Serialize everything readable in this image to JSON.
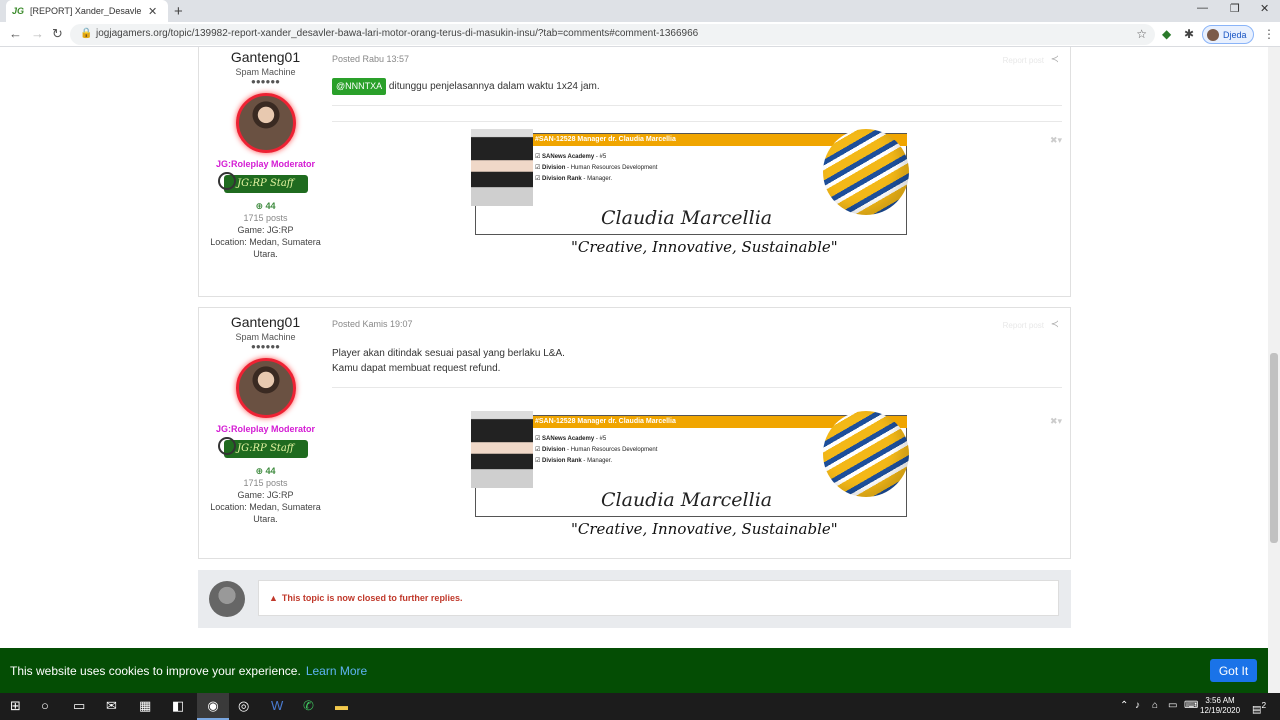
{
  "browser": {
    "tab_title": "[REPORT] Xander_Desavler (Bawa",
    "tab_favicon": "JG",
    "url": "jogjagamers.org/topic/139982-report-xander_desavler-bawa-lari-motor-orang-terus-di-masukin-insu/?tab=comments#comment-1366966",
    "profile_name": "Djeda"
  },
  "posts": [
    {
      "author": "Ganteng01",
      "rank": "Spam Machine",
      "pips": "●●●●●●",
      "group": "JG:Roleplay Moderator",
      "badge": "JG:RP Staff",
      "reputation": "44",
      "posts_count": "1715 posts",
      "game": "Game: JG:RP",
      "location": "Location: Medan, Sumatera Utara.",
      "posted": "Posted Rabu 13:57",
      "report": "Report post",
      "mention": "@NNNTXA",
      "body_1": "ditunggu penjelasannya dalam waktu 1x24 jam.",
      "body_2": ""
    },
    {
      "author": "Ganteng01",
      "rank": "Spam Machine",
      "pips": "●●●●●●",
      "group": "JG:Roleplay Moderator",
      "badge": "JG:RP Staff",
      "reputation": "44",
      "posts_count": "1715 posts",
      "game": "Game: JG:RP",
      "location": "Location: Medan, Sumatera Utara.",
      "posted": "Posted Kamis 19:07",
      "report": "Report post",
      "mention": "",
      "body_1": "Player akan ditindak sesuai pasal yang berlaku L&A.",
      "body_2": "Kamu dapat membuat request refund."
    }
  ],
  "signature": {
    "header": "#SAN-12528 Manager dr. Claudia Marcellia",
    "line1_label": "SANews Academy",
    "line1_value": " - #5",
    "line2_label": "Division",
    "line2_value": " - Human Resources Development",
    "line3_label": "Division Rank",
    "line3_value": " - Manager.",
    "name": "Claudia Marcellia",
    "quote": "\"Creative, Innovative, Sustainable\""
  },
  "closed_notice": "This topic is now closed to further replies.",
  "cookie": {
    "text": "This website uses cookies to improve your experience.",
    "learn_more": "Learn More",
    "button": "Got It"
  },
  "taskbar": {
    "time": "3:56 AM",
    "date": "12/19/2020",
    "notification_count": "2"
  },
  "colors": {
    "group": "#d41cd4",
    "cookie_bg": "#044d04",
    "mention_bg": "#2aa02a",
    "closed_text": "#c0392b",
    "signature_bar": "#f0a500"
  }
}
